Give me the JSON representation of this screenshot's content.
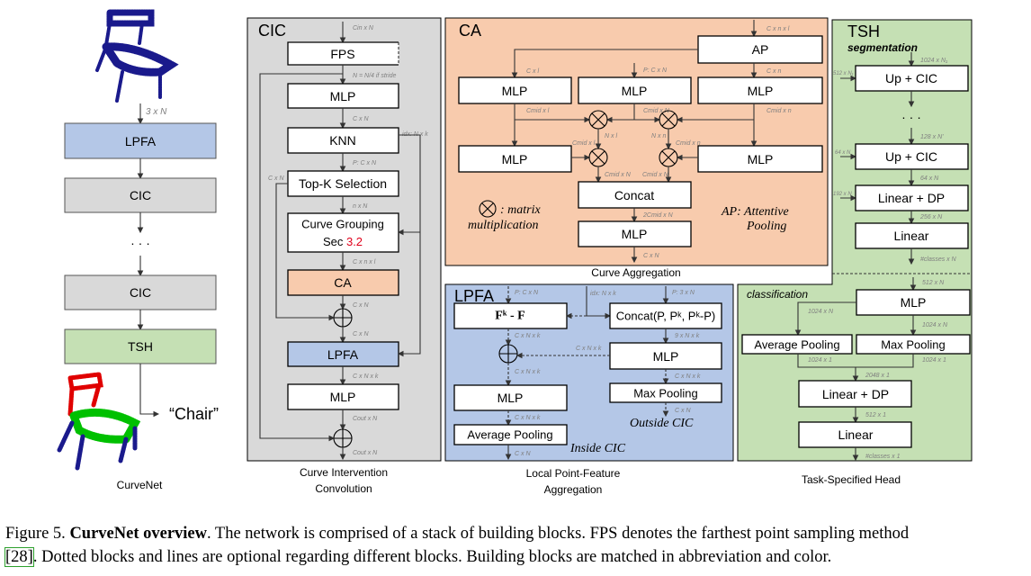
{
  "left": {
    "input_dim": "3 x N",
    "blocks": [
      "LPFA",
      "CIC",
      "· · ·",
      "CIC",
      "TSH"
    ],
    "output_label": "“Chair”",
    "caption": "CurveNet"
  },
  "cic": {
    "title": "CIC",
    "fps": "FPS",
    "mlp1": "MLP",
    "knn": "KNN",
    "topk": "Top-K Selection",
    "grouping": "Curve Grouping",
    "grouping_sec": "Sec ",
    "grouping_ref": "3.2",
    "ca": "CA",
    "lpfa": "LPFA",
    "mlp2": "MLP",
    "dims": {
      "input": "Cin x N",
      "stride": "N = N/4 if stride",
      "mlp_out": "C x N",
      "knn_out": "P: C x N",
      "idx": "idx: N x k",
      "topk_side": "C x N",
      "topk_out": "n x N",
      "group_out": "C x n x l",
      "ca_out": "C x N",
      "add_out": "C x N",
      "lpfa_out": "C x N x k",
      "mlp_out2": "Cout x N",
      "final": "Cout x N"
    },
    "caption_line1": "Curve Intervention",
    "caption_line2": "Convolution"
  },
  "ca": {
    "title": "CA",
    "ap": "AP",
    "mlp": "MLP",
    "concat": "Concat",
    "dims": {
      "input": "C x n x l",
      "cl": "C x l",
      "p": "P: C x N",
      "cn": "C x n",
      "cmid_l": "Cmid x l",
      "cmid_N": "Cmid x N",
      "cmid_n": "Cmid x n",
      "nl": "N x l",
      "nn": "N x n",
      "cmid_l2": "Cmid x l",
      "cmid_n2": "Cmid x n",
      "cmid_N_a": "Cmid x N",
      "cmid_N_b": "Cmid x N",
      "two_cmid": "2Cmid x N",
      "out": "C x N"
    },
    "legend_symbol": ": matrix",
    "legend_text": "multiplication",
    "ap_legend_1": "AP: Attentive",
    "ap_legend_2": "Pooling",
    "caption": "Curve Aggregation"
  },
  "lpfa": {
    "title": "LPFA",
    "fk_f": "Fᵏ - F",
    "concat": "Concat(P, Pᵏ, Pᵏ-P)",
    "mlp_right": "MLP",
    "max_pool": "Max Pooling",
    "mlp_left": "MLP",
    "avg_pool": "Average Pooling",
    "outside": "Outside CIC",
    "inside": "Inside CIC",
    "dims": {
      "p_cn": "P: C x N",
      "idx": "idx: N x k",
      "p_3n": "P: 3 x N",
      "fk_out": "C x N x k",
      "mlp_side": "C x N x k",
      "concat_out": "9 x N x k",
      "mlp_r_out": "C x N x k",
      "max_out": "C x N",
      "add_out": "C x N x k",
      "mlp_l_out": "C x N x k",
      "avg_out": "C x N"
    },
    "caption_line1": "Local Point-Feature",
    "caption_line2": "Aggregation"
  },
  "tsh": {
    "title": "TSH",
    "segmentation": {
      "label": "segmentation",
      "blocks": [
        "Up + CIC",
        "· · ·",
        "Up + CIC",
        "Linear + DP",
        "Linear"
      ],
      "dims": {
        "in": "1024 x N₁",
        "skip1": "512 x N₁",
        "mid": "128 x N'",
        "skip2": "64 x N",
        "up_out": "64 x N",
        "skip3": "192 x N",
        "lin_out": "256 x N",
        "out": "#classes x N"
      }
    },
    "classification": {
      "label": "classification",
      "blocks": [
        "MLP",
        "Average Pooling",
        "Max Pooling",
        "Linear + DP",
        "Linear"
      ],
      "dims": {
        "in": "512 x N",
        "left": "1024 x N",
        "right": "1024 x N",
        "avg_out": "1024 x 1",
        "max_out": "1024 x 1",
        "cat": "2048 x 1",
        "lin_out": "512 x 1",
        "out": "#classes x 1"
      }
    },
    "caption": "Task-Specified Head"
  },
  "colors": {
    "cic": "#d9d9d9",
    "ca": "#f8cbad",
    "lpfa": "#b4c7e7",
    "tsh": "#c5e0b4",
    "ref": "#e0001b",
    "cite_box": "#2ca02c",
    "point_cloud": "#1a1a8c"
  },
  "caption": {
    "figure": "Figure 5.",
    "title": "CurveNet overview",
    "text1": ". The network is comprised of a stack of building blocks. FPS denotes the farthest point sampling method",
    "cite": "[28]",
    "text2": ". Dotted blocks and lines are optional regarding different blocks. Building blocks are matched in abbreviation and color."
  }
}
